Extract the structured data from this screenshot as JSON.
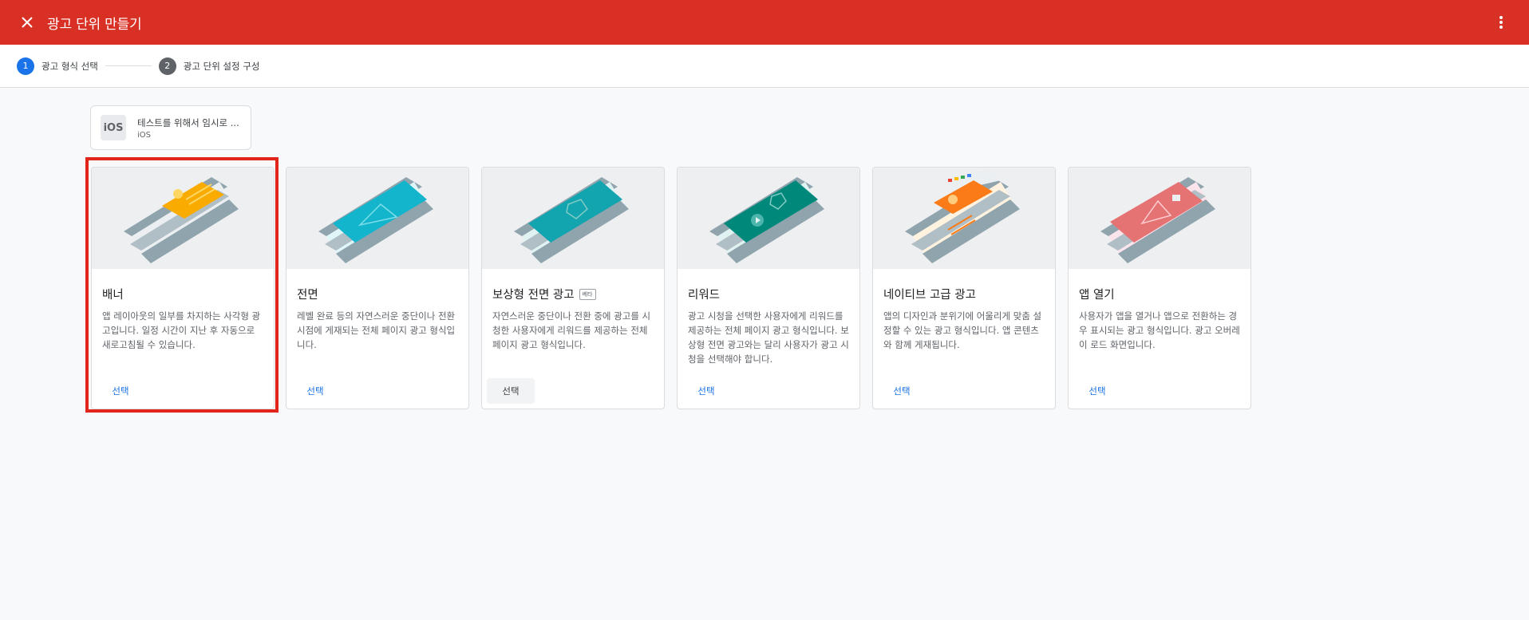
{
  "header": {
    "title": "광고 단위 만들기",
    "close_icon": "close-icon",
    "more_icon": "more-vert-icon"
  },
  "stepper": {
    "steps": [
      {
        "number": "1",
        "label": "광고 형식 선택",
        "state": "active"
      },
      {
        "number": "2",
        "label": "광고 단위 설정 구성",
        "state": "inactive"
      }
    ]
  },
  "app": {
    "icon_label": "iOS",
    "name": "테스트를 위해서 임시로 ...",
    "platform": "iOS"
  },
  "formats": [
    {
      "title": "배너",
      "badge": "",
      "description": "앱 레이아웃의 일부를 차지하는 사각형 광고입니다. 일정 시간이 지난 후 자동으로 새로고침될 수 있습니다.",
      "select_label": "선택",
      "selected": true
    },
    {
      "title": "전면",
      "badge": "",
      "description": "레벨 완료 등의 자연스러운 중단이나 전환 시점에 게재되는 전체 페이지 광고 형식입니다.",
      "select_label": "선택",
      "selected": false
    },
    {
      "title": "보상형 전면 광고",
      "badge": "베타",
      "description": "자연스러운 중단이나 전환 중에 광고를 시청한 사용자에게 리워드를 제공하는 전체 페이지 광고 형식입니다.",
      "select_label": "선택",
      "selected": false
    },
    {
      "title": "리워드",
      "badge": "",
      "description": "광고 시청을 선택한 사용자에게 리워드를 제공하는 전체 페이지 광고 형식입니다. 보상형 전면 광고와는 달리 사용자가 광고 시청을 선택해야 합니다.",
      "select_label": "선택",
      "selected": false
    },
    {
      "title": "네이티브 고급 광고",
      "badge": "",
      "description": "앱의 디자인과 분위기에 어울리게 맞춤 설정할 수 있는 광고 형식입니다. 앱 콘텐츠와 함께 게재됩니다.",
      "select_label": "선택",
      "selected": false
    },
    {
      "title": "앱 열기",
      "badge": "",
      "description": "사용자가 앱을 열거나 앱으로 전환하는 경우 표시되는 광고 형식입니다. 광고 오버레이 로드 화면입니다.",
      "select_label": "선택",
      "selected": false
    }
  ],
  "colors": {
    "header": "#d93025",
    "accent": "#1a73e8",
    "highlight": "#e1251b",
    "banner": "#f9ab00",
    "interstitial": "#12b5cb",
    "rewarded_interstitial": "#12a4af",
    "rewarded": "#00897b",
    "native": "#fa7b17",
    "app_open": "#e57373"
  }
}
